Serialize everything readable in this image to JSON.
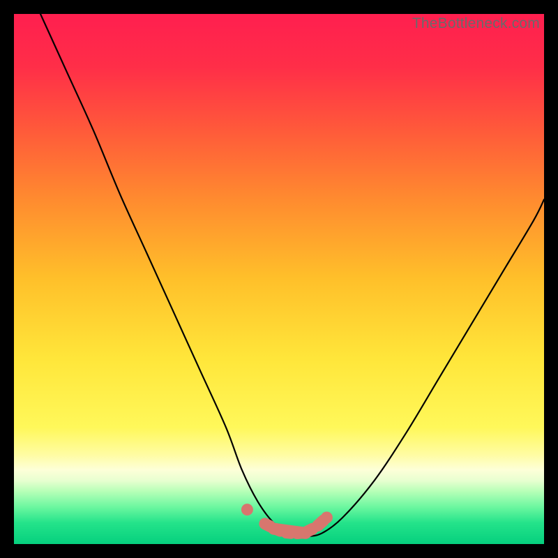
{
  "watermark": "TheBottleneck.com",
  "colors": {
    "frame": "#000000",
    "gradient_stops": [
      {
        "offset": 0.0,
        "color": "#ff1f4f"
      },
      {
        "offset": 0.1,
        "color": "#ff2e48"
      },
      {
        "offset": 0.22,
        "color": "#ff5a3a"
      },
      {
        "offset": 0.35,
        "color": "#ff8b2f"
      },
      {
        "offset": 0.5,
        "color": "#ffc02a"
      },
      {
        "offset": 0.65,
        "color": "#ffe63a"
      },
      {
        "offset": 0.78,
        "color": "#fff85a"
      },
      {
        "offset": 0.83,
        "color": "#fffca0"
      },
      {
        "offset": 0.86,
        "color": "#fdffd8"
      },
      {
        "offset": 0.88,
        "color": "#e8ffd0"
      },
      {
        "offset": 0.9,
        "color": "#b8ffb8"
      },
      {
        "offset": 0.93,
        "color": "#6cf7a0"
      },
      {
        "offset": 0.96,
        "color": "#24e38a"
      },
      {
        "offset": 1.0,
        "color": "#06d07e"
      }
    ],
    "curve": "#000000",
    "marker": "#d8766e"
  },
  "chart_data": {
    "type": "line",
    "title": "",
    "xlabel": "",
    "ylabel": "",
    "xlim": [
      0,
      100
    ],
    "ylim": [
      0,
      100
    ],
    "grid": false,
    "series": [
      {
        "name": "bottleneck-curve",
        "x": [
          5,
          10,
          15,
          20,
          25,
          30,
          35,
          40,
          43,
          46,
          49,
          52,
          55,
          58,
          62,
          68,
          74,
          80,
          86,
          92,
          98,
          100
        ],
        "y": [
          100,
          89,
          78,
          66,
          55,
          44,
          33,
          22,
          14,
          8,
          4,
          2,
          1.5,
          2,
          5,
          12,
          21,
          31,
          41,
          51,
          61,
          65
        ]
      }
    ],
    "markers": {
      "name": "optimum-band",
      "x": [
        44,
        47,
        49,
        51,
        53,
        55,
        57,
        59
      ],
      "y": [
        6.5,
        4.0,
        3.0,
        2.2,
        2.0,
        2.2,
        3.2,
        5.0
      ]
    }
  }
}
